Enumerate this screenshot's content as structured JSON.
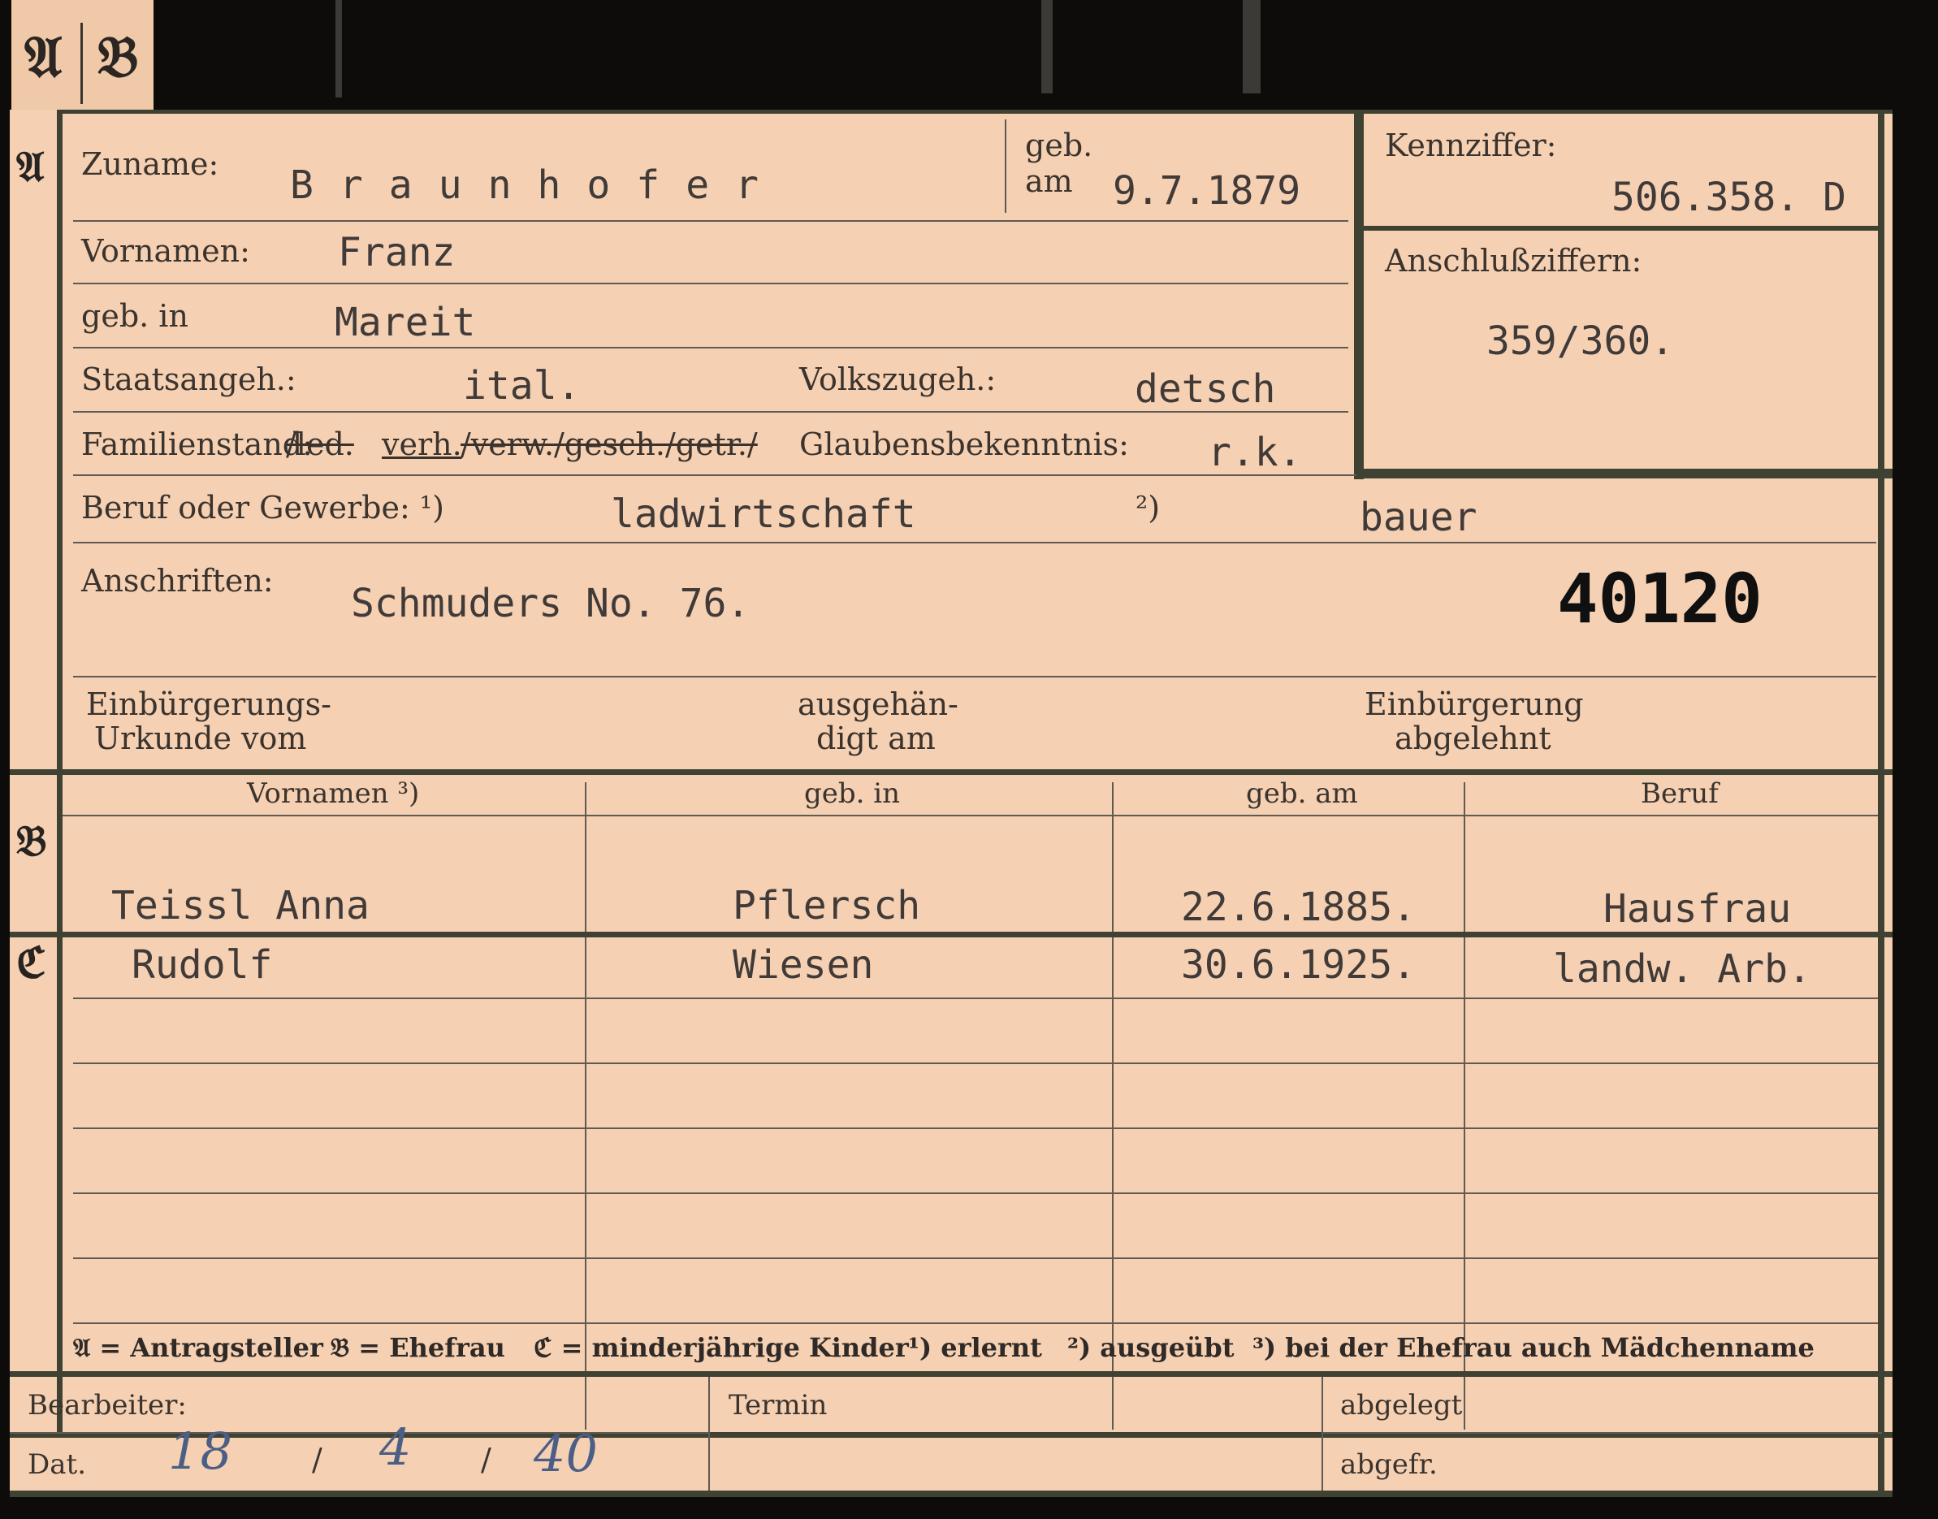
{
  "tab": {
    "letter_a": "𝔄",
    "letter_b": "𝔅"
  },
  "sections": {
    "a": "𝔄",
    "b": "𝔅",
    "c": "ℭ"
  },
  "header": {
    "zuname_label": "Zuname:",
    "zuname_value": "Braunhofer",
    "geb_label_1": "geb.",
    "geb_label_2": "am",
    "geb_am_value": "9.7.1879",
    "kennziffer_label": "Kennziffer:",
    "kennziffer_value": "506.358. D",
    "anschluss_label": "Anschlußziffern:",
    "anschluss_value": "359/360."
  },
  "person": {
    "vornamen_label": "Vornamen:",
    "vornamen_value": "Franz",
    "geb_in_label": "geb. in",
    "geb_in_value": "Mareit",
    "staat_label": "Staatsangeh.:",
    "staat_value": "ital.",
    "volk_label": "Volkszugeh.:",
    "volk_value": "detsch",
    "familienstand_label": "Familienstand:",
    "familienstand_struck_1": "/led.",
    "familienstand_selected": "verh.",
    "familienstand_struck_2": "/verw./gesch./getr./",
    "glauben_label": "Glaubensbekenntnis:",
    "glauben_value": "r.k.",
    "beruf_label": "Beruf oder Gewerbe: ¹)",
    "beruf_value_1": "ladwirtschaft",
    "beruf_mark_2": "²)",
    "beruf_value_2": "bauer",
    "anschriften_label": "Anschriften:",
    "anschriften_value": "Schmuders No. 76.",
    "stamp_number": "40120",
    "einb_label_1": "Einbürgerungs-",
    "einb_label_2": "Urkunde vom",
    "ausgeh_label_1": "ausgehän-",
    "ausgeh_label_2": "digt am",
    "abgelehnt_label_1": "Einbürgerung",
    "abgelehnt_label_2": "abgelehnt"
  },
  "table": {
    "headers": [
      "Vornamen ³)",
      "geb. in",
      "geb. am",
      "Beruf"
    ],
    "spouse": {
      "vornamen": "Teissl Anna",
      "geb_in": "Pflersch",
      "geb_am": "22.6.1885.",
      "beruf": "Hausfrau"
    },
    "children": [
      {
        "vornamen": "Rudolf",
        "geb_in": "Wiesen",
        "geb_am": "30.6.1925.",
        "beruf": "landw. Arb."
      }
    ]
  },
  "legend": {
    "a": "𝔄 = Antragsteller",
    "b": "𝔅 = Ehefrau",
    "c": "ℭ = minderjährige Kinder",
    "n1": "¹) erlernt",
    "n2": "²) ausgeübt",
    "n3": "³) bei der Ehefrau auch Mädchenname"
  },
  "footer": {
    "bearbeiter_label": "Bearbeiter:",
    "dat_label": "Dat.",
    "dat_day": "18",
    "dat_month": "4",
    "dat_year": "40",
    "sep": "/",
    "termin_label": "Termin",
    "abgelegt_label": "abgelegt",
    "abgefr_label": "abgefr."
  }
}
